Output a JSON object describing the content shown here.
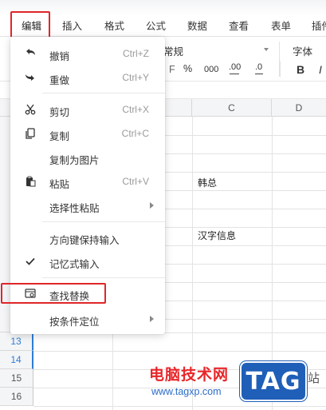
{
  "menubar": {
    "items": [
      {
        "label": "编辑"
      },
      {
        "label": "插入"
      },
      {
        "label": "格式"
      },
      {
        "label": "公式"
      },
      {
        "label": "数据"
      },
      {
        "label": "查看"
      },
      {
        "label": "表单"
      },
      {
        "label": "插件"
      }
    ]
  },
  "toolbar": {
    "format_label": "常规",
    "percent": "%",
    "thousands": "000",
    "dec_inc": ".00",
    "dec_dec": ".0",
    "font_label": "字体",
    "bold": "B",
    "italic": "I",
    "partial": "F"
  },
  "grid": {
    "col_c": "C",
    "col_d": "D",
    "cells": {
      "c4": "韩总",
      "c7": "汉字信息"
    },
    "rows": [
      "13",
      "14",
      "15",
      "16"
    ]
  },
  "edit_menu": {
    "items": [
      {
        "label": "撤销",
        "shortcut": "Ctrl+Z",
        "icon": "undo-icon"
      },
      {
        "label": "重做",
        "shortcut": "Ctrl+Y",
        "icon": "redo-icon"
      },
      {
        "label": "剪切",
        "shortcut": "Ctrl+X",
        "icon": "scissors-icon"
      },
      {
        "label": "复制",
        "shortcut": "Ctrl+C",
        "icon": "copy-icon"
      },
      {
        "label": "复制为图片",
        "shortcut": "",
        "icon": ""
      },
      {
        "label": "粘贴",
        "shortcut": "Ctrl+V",
        "icon": "paste-icon"
      },
      {
        "label": "选择性粘贴",
        "shortcut": "",
        "icon": "",
        "submenu": true
      },
      {
        "label": "方向键保持输入",
        "shortcut": "",
        "icon": ""
      },
      {
        "label": "记忆式输入",
        "shortcut": "",
        "icon": "checkmark-icon"
      },
      {
        "label": "查找替换",
        "shortcut": "",
        "icon": "find-replace-icon"
      },
      {
        "label": "按条件定位",
        "shortcut": "",
        "icon": "",
        "submenu": true
      }
    ]
  },
  "watermark": {
    "title": "电脑技术网",
    "url": "www.tagxp.com",
    "logo": "TAG",
    "extra": "站"
  },
  "colors": {
    "highlight": "#e0262a",
    "selection": "#2f7dd6",
    "logo_bg": "#1f5fb8"
  }
}
